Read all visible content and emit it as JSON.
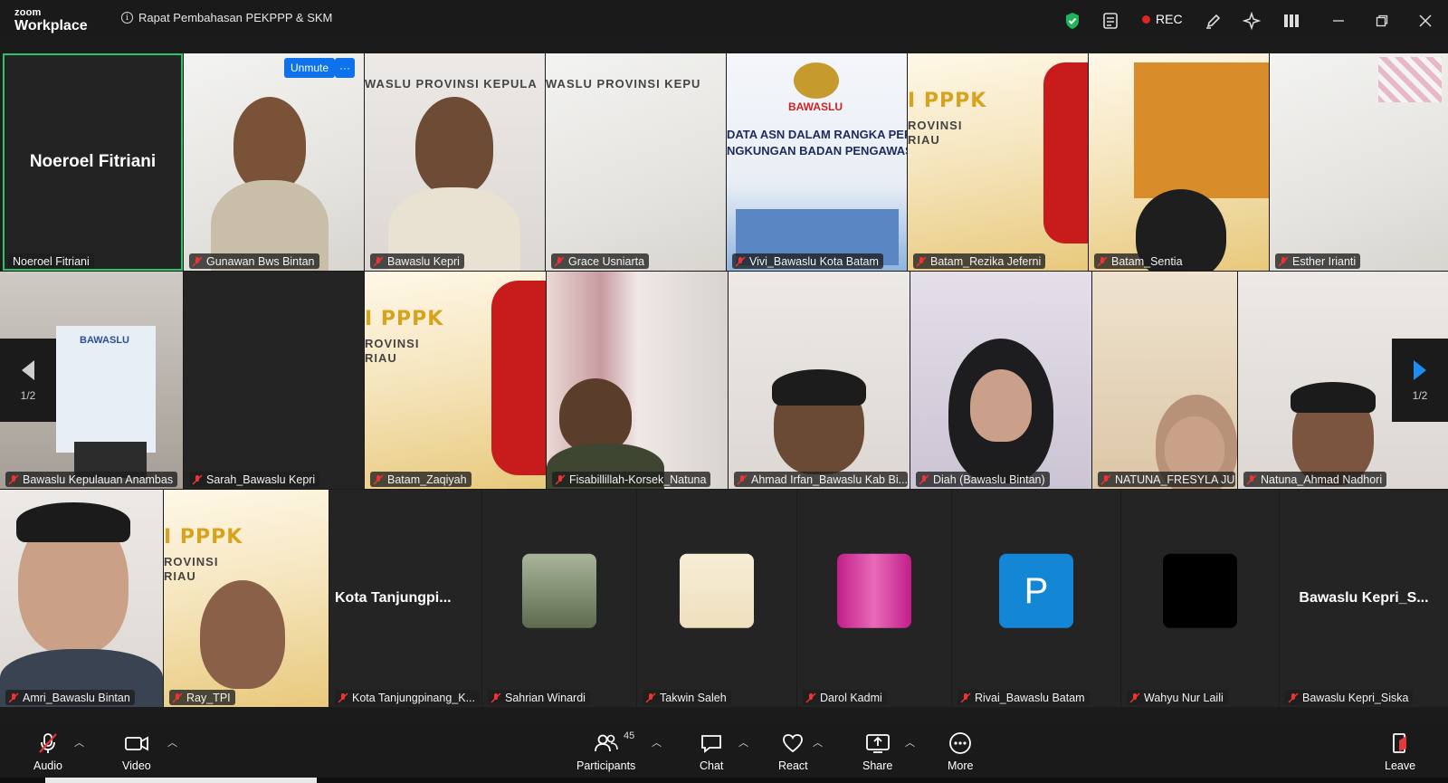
{
  "app": {
    "logo_line1": "zoom",
    "logo_line2": "Workplace",
    "meeting_title": "Rapat Pembahasan PEKPPP & SKM",
    "rec_label": "REC",
    "accent_color": "#0e72ed",
    "active_speaker_color": "#27c46a"
  },
  "tile_controls": {
    "unmute_label": "Unmute",
    "more_label": "···"
  },
  "pager": {
    "left_label": "1/2",
    "right_label": "1/2"
  },
  "tiles": {
    "t1": {
      "name": "Noeroel Fitriani",
      "center": "Noeroel Fitriani"
    },
    "t2": {
      "name": "Gunawan Bws Bintan"
    },
    "t3": {
      "name": "Bawaslu Kepri",
      "banner": "WASLU PROVINSI KEPULA"
    },
    "t4": {
      "name": "Grace Usniarta",
      "banner": "WASLU PROVINSI KEPU"
    },
    "t5": {
      "name": "Vivi_Bawaslu Kota Batam",
      "banner": "DATA ASN DALAM RANGKA PERSIAPAN MA",
      "banner2": "NGKUNGAN BADAN PENGAWAS PEMILIHAN",
      "logo": "BAWASLU"
    },
    "t6": {
      "name": "Batam_Rezika Jeferni",
      "banner": "I PPPK",
      "banner2": "ROVINSI",
      "banner3": "RIAU"
    },
    "t7": {
      "name": "Batam_Sentia"
    },
    "t8": {
      "name": "Esther Irianti"
    },
    "t9": {
      "name": "Bawaslu Kepulauan Anambas",
      "banner": "BAWASLU"
    },
    "t10": {
      "name": "Sarah_Bawaslu Kepri"
    },
    "t11": {
      "name": "Batam_Zaqiyah",
      "banner": "I PPPK",
      "banner2": "ROVINSI",
      "banner3": "RIAU"
    },
    "t12": {
      "name": "Fisabillillah-Korsek_Natuna"
    },
    "t13": {
      "name": "Ahmad Irfan_Bawaslu Kab Bi..."
    },
    "t14": {
      "name": "Diah (Bawaslu Bintan)"
    },
    "t15": {
      "name": "NATUNA_FRESYLA JU..."
    },
    "t16": {
      "name": "Natuna_Ahmad Nadhori"
    },
    "t17": {
      "name": "Amri_Bawaslu Bintan"
    },
    "t18": {
      "name": "Ray_TPI",
      "banner": "I PPPK",
      "banner2": "ROVINSI",
      "banner3": "RIAU"
    },
    "t19": {
      "name": "Kota Tanjungpinang_K...",
      "center": "Kota  Tanjungpi..."
    },
    "t20": {
      "name": "Sahrian Winardi"
    },
    "t21": {
      "name": "Takwin Saleh"
    },
    "t22": {
      "name": "Darol Kadmi"
    },
    "t23": {
      "name": "Rivai_Bawaslu Batam",
      "avatar_letter": "P"
    },
    "t24": {
      "name": "Wahyu Nur Laili"
    },
    "t25": {
      "name": "Bawaslu Kepri_Siska",
      "center": "Bawaslu  Kepri_S..."
    }
  },
  "toolbar": {
    "audio": "Audio",
    "video": "Video",
    "participants": "Participants",
    "participants_count": "45",
    "chat": "Chat",
    "react": "React",
    "share": "Share",
    "more": "More",
    "leave": "Leave"
  },
  "icons": {
    "shield": "shield-check-icon",
    "notes": "notes-icon",
    "annotate": "pen-icon",
    "ai": "sparkle-icon",
    "layout": "gallery-layout-icon",
    "minimize": "minimize-icon",
    "restore": "restore-icon",
    "close": "close-icon"
  }
}
